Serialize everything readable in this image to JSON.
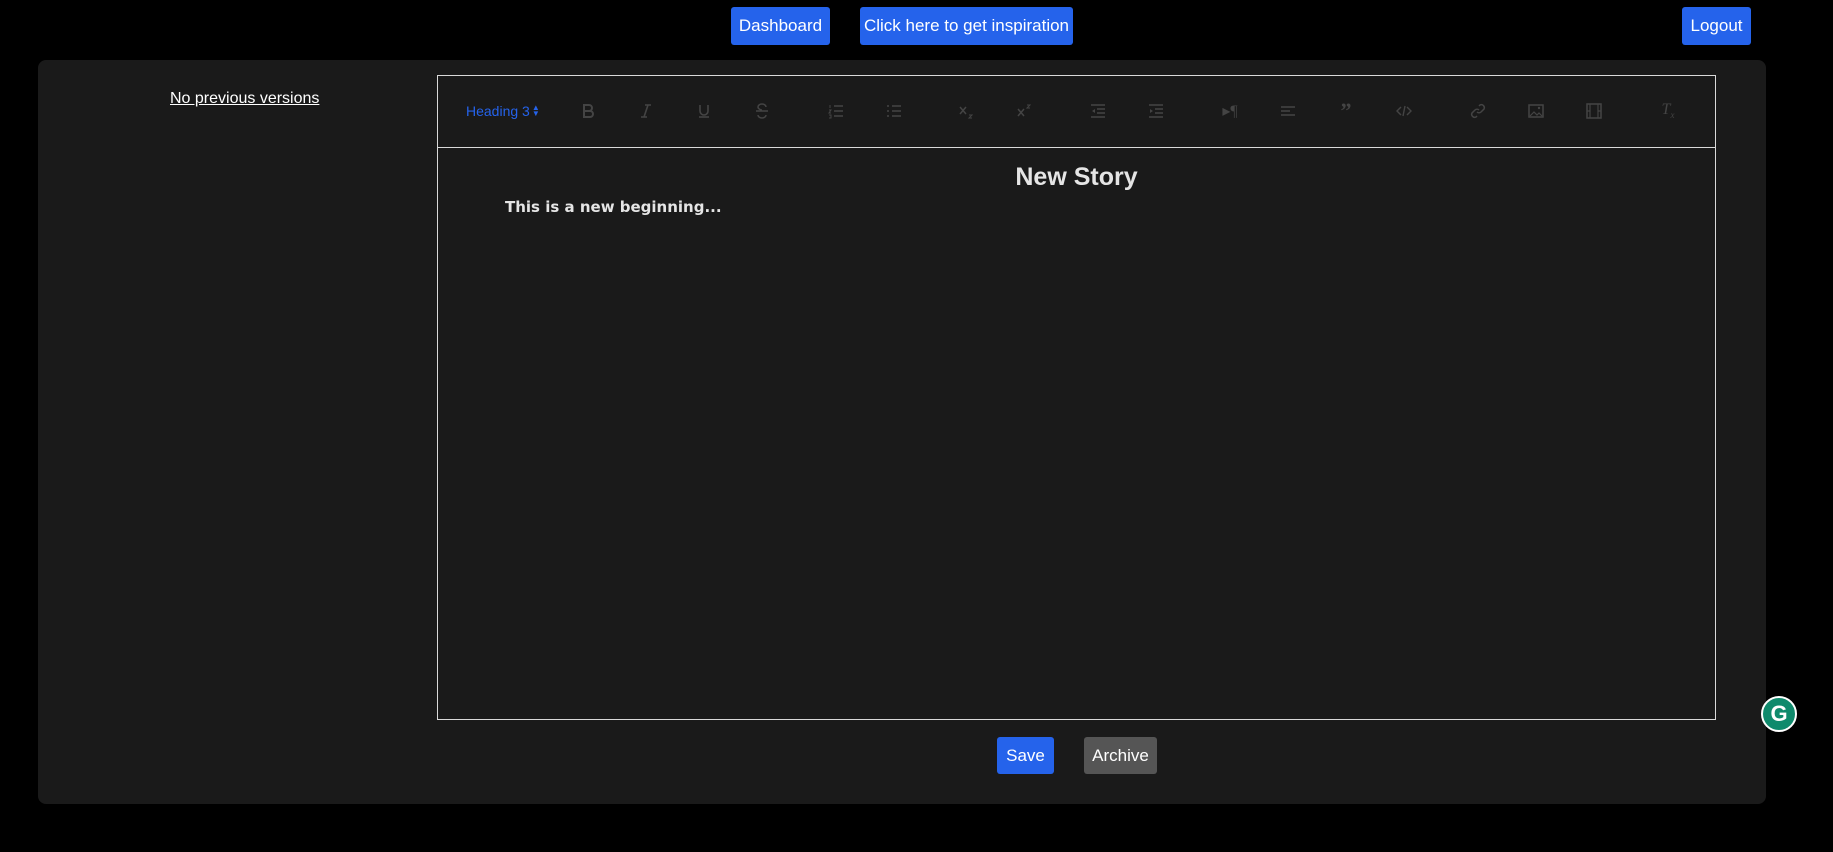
{
  "nav": {
    "dashboard_label": "Dashboard",
    "inspiration_label": "Click here to get inspiration",
    "logout_label": "Logout"
  },
  "sidebar": {
    "versions_label": "No previous versions"
  },
  "toolbar": {
    "heading_value": "Heading 3",
    "items": [
      "bold-icon",
      "italic-icon",
      "underline-icon",
      "strikethrough-icon",
      "ordered-list-icon",
      "bullet-list-icon",
      "subscript-icon",
      "superscript-icon",
      "outdent-icon",
      "indent-icon",
      "text-direction-icon",
      "align-icon",
      "blockquote-icon",
      "code-icon",
      "link-icon",
      "image-icon",
      "video-icon",
      "clear-format-icon"
    ]
  },
  "editor": {
    "title": "New Story",
    "body": "This is a new beginning..."
  },
  "actions": {
    "save_label": "Save",
    "archive_label": "Archive"
  },
  "colors": {
    "accent": "#2563eb",
    "panel": "#1a1a1a",
    "background": "#000000",
    "archive": "#555555",
    "grammarly": "#0f8a6c"
  }
}
